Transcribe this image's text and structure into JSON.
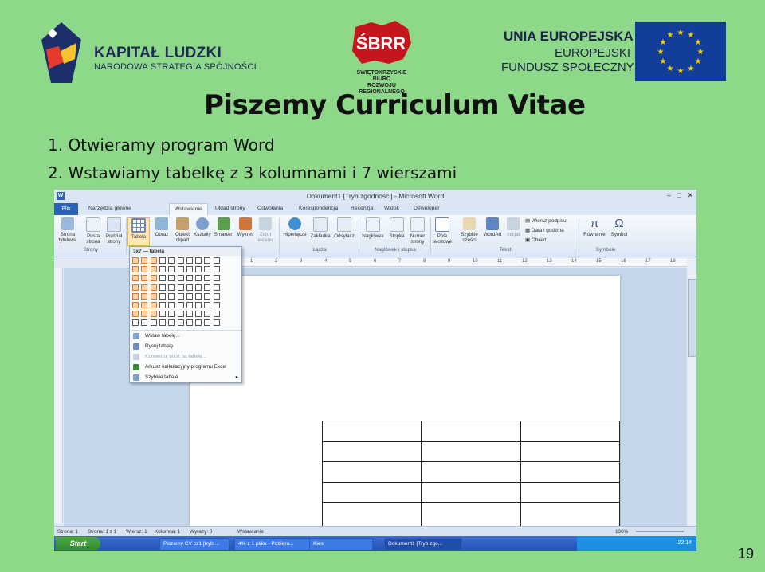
{
  "header": {
    "kl_title": "KAPITAŁ LUDZKI",
    "kl_subtitle": "NARODOWA STRATEGIA SPÓJNOŚCI",
    "sbrr_logo_text": "ŚBRR",
    "sbrr_line1": "ŚWIĘTOKRZYSKIE BIURO",
    "sbrr_line2": "ROZWOJU REGIONALNEGO",
    "ue_title": "UNIA EUROPEJSKA",
    "ue_line2": "EUROPEJSKI",
    "ue_line3": "FUNDUSZ SPOŁECZNY"
  },
  "slide": {
    "heading": "Piszemy Curriculum Vitae",
    "step1": "1.  Otwieramy program Word",
    "step2": "2.  Wstawiamy tabelkę z 3 kolumnami i 7 wierszami",
    "page_number": "19"
  },
  "word": {
    "window_title": "Dokument1 [Tryb zgodności] - Microsoft Word",
    "tabs": [
      "Plik",
      "Narzędzia główne",
      "Wstawianie",
      "Układ strony",
      "Odwołania",
      "Korespondencja",
      "Recenzja",
      "Widok",
      "Deweloper"
    ],
    "active_tab": "Wstawianie",
    "ribbon": {
      "strony": [
        "Strona tytułowa",
        "Pusta strona",
        "Podział strony"
      ],
      "tabela": "Tabela",
      "ilustracje": [
        "Obraz",
        "Obiekt clipart",
        "Kształty",
        "SmartArt",
        "Wykres",
        "Zrzut ekranu"
      ],
      "lacza": [
        "Hiperłącze",
        "Zakładka",
        "Odsyłacz"
      ],
      "naglowek": [
        "Nagłówek",
        "Stopka",
        "Numer strony"
      ],
      "tekst": [
        "Pole tekstowe",
        "Szybkie części",
        "WordArt",
        "Inicjał"
      ],
      "tekst_small": [
        "Wiersz podpisu",
        "Data i godzina",
        "Obiekt"
      ],
      "symbole": [
        "Równanie",
        "Symbol"
      ],
      "groups": [
        "Strony",
        "Łącza",
        "Nagłówek i stopka",
        "Tekst",
        "Symbole"
      ]
    },
    "ruler_marks": [
      "1",
      "2",
      "3",
      "4",
      "5",
      "6",
      "7",
      "8",
      "9",
      "10",
      "11",
      "12",
      "13",
      "14",
      "15",
      "16",
      "17",
      "18"
    ],
    "table_menu": {
      "header": "3x7 — tabela",
      "selected_cols": 3,
      "selected_rows": 7,
      "items": [
        {
          "label": "Wstaw tabelę...",
          "disabled": false
        },
        {
          "label": "Rysuj tabelę",
          "disabled": false
        },
        {
          "label": "Konwertuj tekst na tabelę...",
          "disabled": true
        },
        {
          "label": "Arkusz kalkulacyjny programu Excel",
          "disabled": false
        },
        {
          "label": "Szybkie tabele",
          "disabled": false
        }
      ]
    },
    "status": {
      "page": "Strona: 1",
      "section": "Strona: 1 z 1",
      "row": "Wiersz: 1",
      "column": "Kolumna: 1",
      "words": "Wyrazy: 0",
      "mode": "Wstawianie",
      "zoom": "130%"
    },
    "taskbar": {
      "start": "Start",
      "items": [
        "Piszemy CV cz1 [tryb ...",
        "4% z 1 pliku - Pobiera...",
        "Kies",
        "Dokument1 [Tryb zgo..."
      ],
      "clock": "22:14"
    }
  },
  "colors": {
    "slide_bg": "#8ed989",
    "word_blue": "#2b62b8",
    "menu_highlight": "#e0782a"
  }
}
